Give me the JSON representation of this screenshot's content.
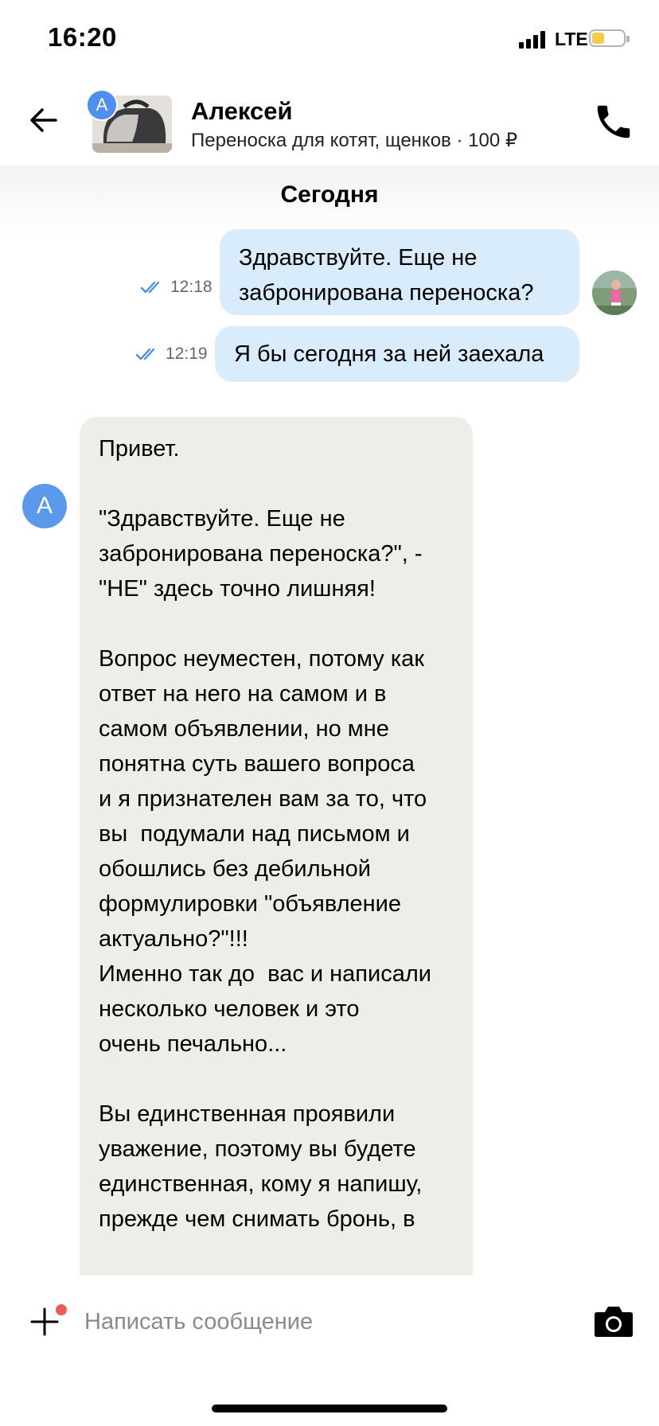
{
  "status_bar": {
    "time": "16:20",
    "network": "LTE",
    "battery_level": 0.4
  },
  "header": {
    "avatar_letter": "А",
    "name": "Алексей",
    "subtitle": "Переноска для котят, щенков · 100 ₽",
    "icons": {
      "back": "arrow-left-icon",
      "call": "phone-icon"
    }
  },
  "chat": {
    "day_label": "Сегодня",
    "messages": [
      {
        "direction": "outgoing",
        "time": "12:18",
        "status": "read",
        "text": "Здравствуйте. Еще не\nзабронирована переноска?"
      },
      {
        "direction": "outgoing",
        "time": "12:19",
        "status": "read",
        "text": "Я бы сегодня за ней заехала"
      },
      {
        "direction": "incoming",
        "sender_avatar_letter": "А",
        "text": "Привет.\n\n\"Здравствуйте. Еще не\nзабронирована переноска?\", -\n\"НЕ\" здесь точно лишняя!\n\nВопрос неуместен, потому как\nответ на него на самом и в\nсамом объявлении, но мне\nпонятна суть вашего вопроса\nи я признателен вам за то, что\nвы  подумали над письмом и\nобошлись без дебильной\nформулировки \"объявление\nактуально?\"!!!\nИменно так до  вас и написали\nнесколько человек и это\nочень печально...\n\nВы единственная проявили\nуважение, поэтому вы будете\nединственная, кому я напишу,\nпрежде чем снимать бронь, в"
      }
    ]
  },
  "composer": {
    "placeholder": "Написать сообщение",
    "has_attachment_notification": true,
    "icons": {
      "add": "plus-icon",
      "camera": "camera-icon"
    }
  },
  "colors": {
    "outgoing_bubble": "#d9ecfb",
    "incoming_bubble": "#efede8",
    "accent": "#4f8ff0",
    "read_ticks": "#4a90e2",
    "notification_dot": "#ee5b5b"
  }
}
